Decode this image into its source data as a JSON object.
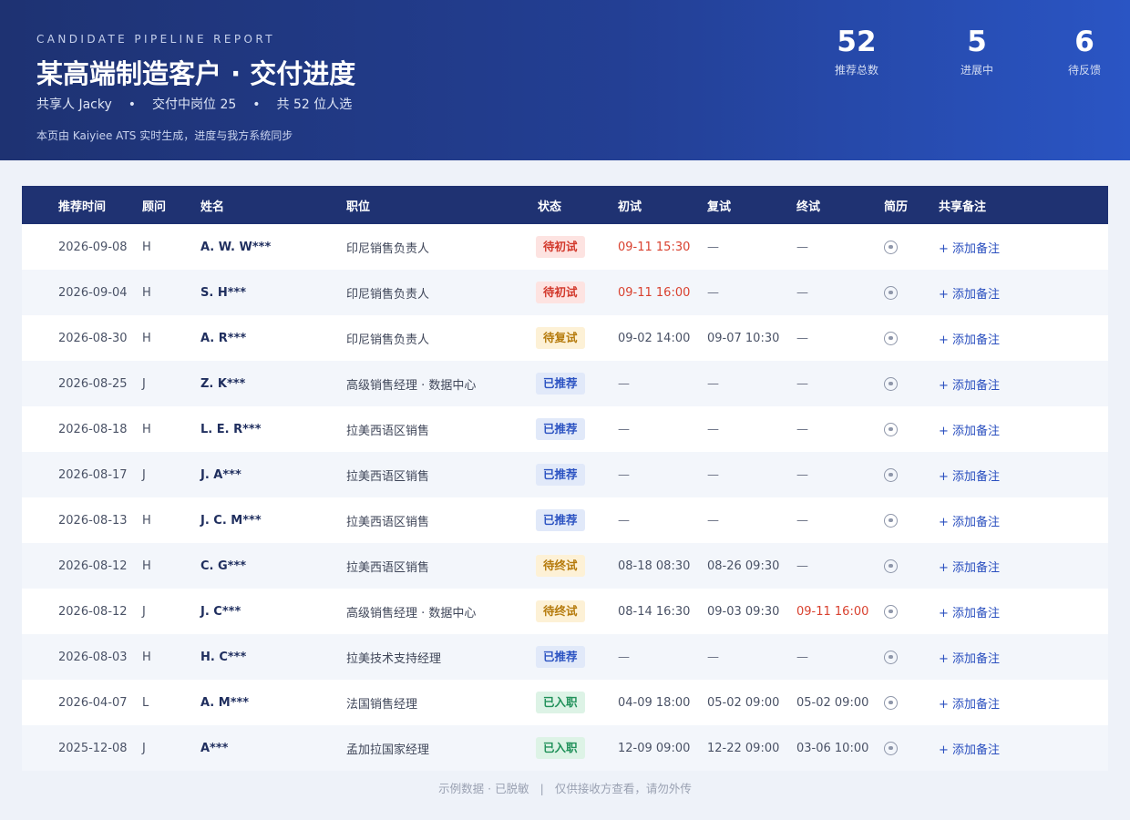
{
  "header": {
    "eyebrow": "CANDIDATE PIPELINE REPORT",
    "title": "某高端制造客户 · 交付进度",
    "meta": [
      "共享人 Jacky",
      "交付中岗位 25",
      "共 52 位人选"
    ],
    "meta_separator": "•",
    "note": "本页由 Kaiyiee ATS 实时生成，进度与我方系统同步"
  },
  "stats": [
    {
      "value": "52",
      "label": "推荐总数"
    },
    {
      "value": "5",
      "label": "进展中"
    },
    {
      "value": "6",
      "label": "待反馈"
    }
  ],
  "table": {
    "columns": {
      "date": "推荐时间",
      "recruiter": "顾问",
      "name": "姓名",
      "position": "职位",
      "status": "状态",
      "interview1": "初试",
      "interview2": "复试",
      "interview3": "终试",
      "resume": "简历",
      "note": "共享备注"
    },
    "note_action": "+ 添加备注",
    "rows": [
      {
        "date": "2026-09-08",
        "recruiter": "H",
        "name": "A. W. W***",
        "position": "印尼销售负责人",
        "status": "待初试",
        "status_type": "pending1",
        "i1": "09-11 15:30",
        "i1_alert": true,
        "i2": "—",
        "i2_alert": false,
        "i3": "—",
        "i3_alert": false
      },
      {
        "date": "2026-09-04",
        "recruiter": "H",
        "name": "S. H***",
        "position": "印尼销售负责人",
        "status": "待初试",
        "status_type": "pending1",
        "i1": "09-11 16:00",
        "i1_alert": true,
        "i2": "—",
        "i2_alert": false,
        "i3": "—",
        "i3_alert": false
      },
      {
        "date": "2026-08-30",
        "recruiter": "H",
        "name": "A. R***",
        "position": "印尼销售负责人",
        "status": "待复试",
        "status_type": "pending2",
        "i1": "09-02 14:00",
        "i1_alert": false,
        "i2": "09-07 10:30",
        "i2_alert": false,
        "i3": "—",
        "i3_alert": false
      },
      {
        "date": "2026-08-25",
        "recruiter": "J",
        "name": "Z. K***",
        "position": "高级销售经理 · 数据中心",
        "status": "已推荐",
        "status_type": "rec",
        "i1": "—",
        "i1_alert": false,
        "i2": "—",
        "i2_alert": false,
        "i3": "—",
        "i3_alert": false
      },
      {
        "date": "2026-08-18",
        "recruiter": "H",
        "name": "L. E. R***",
        "position": "拉美西语区销售",
        "status": "已推荐",
        "status_type": "rec",
        "i1": "—",
        "i1_alert": false,
        "i2": "—",
        "i2_alert": false,
        "i3": "—",
        "i3_alert": false
      },
      {
        "date": "2026-08-17",
        "recruiter": "J",
        "name": "J. A***",
        "position": "拉美西语区销售",
        "status": "已推荐",
        "status_type": "rec",
        "i1": "—",
        "i1_alert": false,
        "i2": "—",
        "i2_alert": false,
        "i3": "—",
        "i3_alert": false
      },
      {
        "date": "2026-08-13",
        "recruiter": "H",
        "name": "J. C. M***",
        "position": "拉美西语区销售",
        "status": "已推荐",
        "status_type": "rec",
        "i1": "—",
        "i1_alert": false,
        "i2": "—",
        "i2_alert": false,
        "i3": "—",
        "i3_alert": false
      },
      {
        "date": "2026-08-12",
        "recruiter": "H",
        "name": "C. G***",
        "position": "拉美西语区销售",
        "status": "待终试",
        "status_type": "pending3",
        "i1": "08-18 08:30",
        "i1_alert": false,
        "i2": "08-26 09:30",
        "i2_alert": false,
        "i3": "—",
        "i3_alert": false
      },
      {
        "date": "2026-08-12",
        "recruiter": "J",
        "name": "J. C***",
        "position": "高级销售经理 · 数据中心",
        "status": "待终试",
        "status_type": "pending3",
        "i1": "08-14 16:30",
        "i1_alert": false,
        "i2": "09-03 09:30",
        "i2_alert": false,
        "i3": "09-11 16:00",
        "i3_alert": true
      },
      {
        "date": "2026-08-03",
        "recruiter": "H",
        "name": "H. C***",
        "position": "拉美技术支持经理",
        "status": "已推荐",
        "status_type": "rec",
        "i1": "—",
        "i1_alert": false,
        "i2": "—",
        "i2_alert": false,
        "i3": "—",
        "i3_alert": false
      },
      {
        "date": "2026-04-07",
        "recruiter": "L",
        "name": "A. M***",
        "position": "法国销售经理",
        "status": "已入职",
        "status_type": "hired",
        "i1": "04-09 18:00",
        "i1_alert": false,
        "i2": "05-02 09:00",
        "i2_alert": false,
        "i3": "05-02 09:00",
        "i3_alert": false
      },
      {
        "date": "2025-12-08",
        "recruiter": "J",
        "name": "A***",
        "position": "孟加拉国家经理",
        "status": "已入职",
        "status_type": "hired",
        "i1": "12-09 09:00",
        "i1_alert": false,
        "i2": "12-22 09:00",
        "i2_alert": false,
        "i3": "03-06 10:00",
        "i3_alert": false
      }
    ]
  },
  "footer": {
    "left": "示例数据 · 已脱敏",
    "separator": "|",
    "right": "仅供接收方查看，请勿外传"
  },
  "colors": {
    "header_start": "#1e3272",
    "header_end": "#2a55c4",
    "alert_red": "#d9412f",
    "link_blue": "#2a4fbf"
  }
}
